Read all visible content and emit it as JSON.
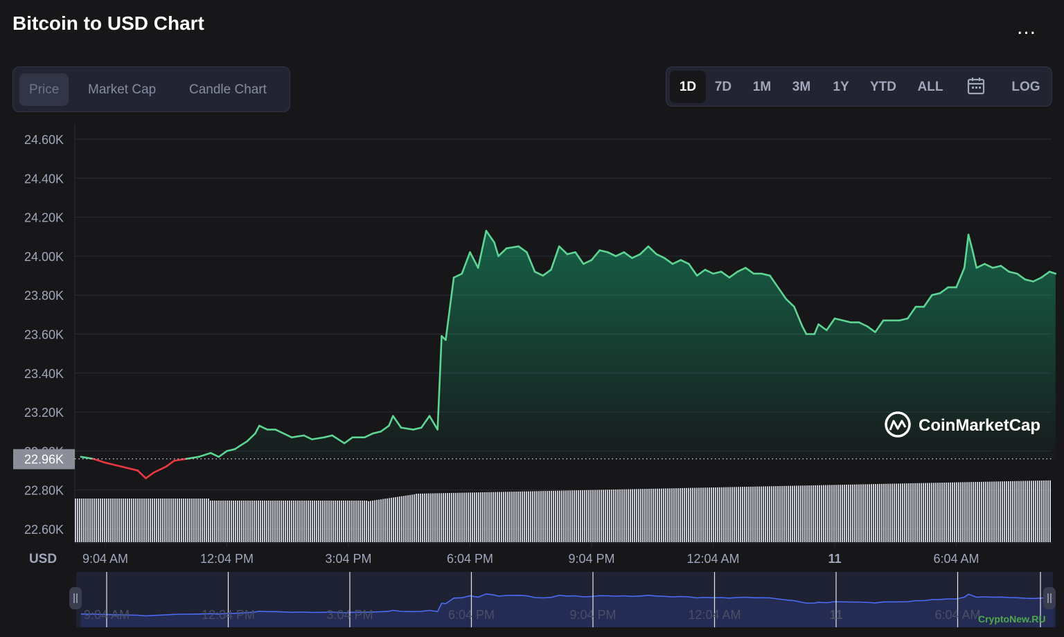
{
  "header": {
    "title": "Bitcoin to USD Chart",
    "more_label": "..."
  },
  "tabs": [
    {
      "label": "Price",
      "active": true
    },
    {
      "label": "Market Cap",
      "active": false
    },
    {
      "label": "Candle Chart",
      "active": false
    }
  ],
  "ranges": [
    {
      "label": "1D",
      "active": true
    },
    {
      "label": "7D",
      "active": false
    },
    {
      "label": "1M",
      "active": false
    },
    {
      "label": "3M",
      "active": false
    },
    {
      "label": "1Y",
      "active": false
    },
    {
      "label": "YTD",
      "active": false
    },
    {
      "label": "ALL",
      "active": false
    }
  ],
  "calendar_icon": "calendar-icon",
  "log_label": "LOG",
  "brand": {
    "name": "CoinMarketCap",
    "logo_icon": "coinmarketcap-logo-icon"
  },
  "watermark": "CryptoNew.RU",
  "colors": {
    "up": "#16c784",
    "up_line": "#5ed592",
    "down": "#ea3943",
    "background": "#17171a",
    "panel": "#222531",
    "navigator_line": "#4a6cf7"
  },
  "chart_data": {
    "type": "area",
    "title": "Bitcoin to USD Chart",
    "ylabel": "USD",
    "xlabel": "",
    "ylim": [
      22.55,
      24.65
    ],
    "y_unit": "K",
    "y_ticks": [
      "24.60K",
      "24.40K",
      "24.20K",
      "24.00K",
      "23.80K",
      "23.60K",
      "23.40K",
      "23.20K",
      "23.00K",
      "22.80K",
      "22.60K"
    ],
    "reference_value": 22.96,
    "reference_label": "22.96K",
    "x_ticks": [
      "9:04 AM",
      "12:04 PM",
      "3:04 PM",
      "6:04 PM",
      "9:04 PM",
      "12:04 AM",
      "11",
      "6:04 AM"
    ],
    "x_tick_hours": [
      0,
      3,
      6,
      9,
      12,
      15,
      18,
      21
    ],
    "x_unit": "hours after 9:04 AM",
    "xlim": [
      -0.6,
      23.45
    ],
    "series": [
      {
        "values": [
          [
            -0.6,
            22.97
          ],
          [
            -0.3,
            22.96
          ],
          [
            0.0,
            22.94
          ],
          [
            0.4,
            22.92
          ],
          [
            0.8,
            22.9
          ],
          [
            1.0,
            22.86
          ],
          [
            1.2,
            22.89
          ],
          [
            1.5,
            22.92
          ],
          [
            1.7,
            22.95
          ],
          [
            2.0,
            22.96
          ],
          [
            2.3,
            22.97
          ],
          [
            2.6,
            22.99
          ],
          [
            2.8,
            22.97
          ],
          [
            3.0,
            23.0
          ],
          [
            3.2,
            23.01
          ],
          [
            3.5,
            23.05
          ],
          [
            3.7,
            23.09
          ],
          [
            3.8,
            23.13
          ],
          [
            4.0,
            23.11
          ],
          [
            4.2,
            23.11
          ],
          [
            4.4,
            23.09
          ],
          [
            4.6,
            23.07
          ],
          [
            4.9,
            23.08
          ],
          [
            5.1,
            23.06
          ],
          [
            5.4,
            23.07
          ],
          [
            5.6,
            23.08
          ],
          [
            5.9,
            23.04
          ],
          [
            6.1,
            23.07
          ],
          [
            6.4,
            23.07
          ],
          [
            6.6,
            23.09
          ],
          [
            6.8,
            23.1
          ],
          [
            7.0,
            23.13
          ],
          [
            7.1,
            23.18
          ],
          [
            7.3,
            23.12
          ],
          [
            7.6,
            23.11
          ],
          [
            7.8,
            23.12
          ],
          [
            8.0,
            23.18
          ],
          [
            8.2,
            23.11
          ],
          [
            8.3,
            23.59
          ],
          [
            8.4,
            23.57
          ],
          [
            8.6,
            23.89
          ],
          [
            8.8,
            23.91
          ],
          [
            9.0,
            24.02
          ],
          [
            9.2,
            23.94
          ],
          [
            9.4,
            24.13
          ],
          [
            9.6,
            24.07
          ],
          [
            9.7,
            24.0
          ],
          [
            9.9,
            24.04
          ],
          [
            10.2,
            24.05
          ],
          [
            10.4,
            24.02
          ],
          [
            10.6,
            23.92
          ],
          [
            10.8,
            23.9
          ],
          [
            11.0,
            23.93
          ],
          [
            11.2,
            24.05
          ],
          [
            11.4,
            24.01
          ],
          [
            11.6,
            24.02
          ],
          [
            11.8,
            23.96
          ],
          [
            12.0,
            23.98
          ],
          [
            12.2,
            24.03
          ],
          [
            12.4,
            24.02
          ],
          [
            12.6,
            24.0
          ],
          [
            12.8,
            24.02
          ],
          [
            13.0,
            23.99
          ],
          [
            13.2,
            24.01
          ],
          [
            13.4,
            24.05
          ],
          [
            13.6,
            24.01
          ],
          [
            13.8,
            23.99
          ],
          [
            14.0,
            23.96
          ],
          [
            14.2,
            23.98
          ],
          [
            14.4,
            23.96
          ],
          [
            14.6,
            23.9
          ],
          [
            14.8,
            23.93
          ],
          [
            15.0,
            23.91
          ],
          [
            15.2,
            23.92
          ],
          [
            15.4,
            23.89
          ],
          [
            15.6,
            23.92
          ],
          [
            15.8,
            23.94
          ],
          [
            16.0,
            23.91
          ],
          [
            16.2,
            23.91
          ],
          [
            16.4,
            23.9
          ],
          [
            16.6,
            23.84
          ],
          [
            16.8,
            23.78
          ],
          [
            17.0,
            23.74
          ],
          [
            17.2,
            23.64
          ],
          [
            17.3,
            23.6
          ],
          [
            17.5,
            23.6
          ],
          [
            17.6,
            23.65
          ],
          [
            17.8,
            23.62
          ],
          [
            18.0,
            23.68
          ],
          [
            18.2,
            23.67
          ],
          [
            18.4,
            23.66
          ],
          [
            18.6,
            23.66
          ],
          [
            18.8,
            23.64
          ],
          [
            19.0,
            23.61
          ],
          [
            19.2,
            23.67
          ],
          [
            19.4,
            23.67
          ],
          [
            19.6,
            23.67
          ],
          [
            19.8,
            23.68
          ],
          [
            20.0,
            23.74
          ],
          [
            20.2,
            23.74
          ],
          [
            20.4,
            23.8
          ],
          [
            20.6,
            23.81
          ],
          [
            20.8,
            23.84
          ],
          [
            21.0,
            23.84
          ],
          [
            21.2,
            23.94
          ],
          [
            21.3,
            24.11
          ],
          [
            21.4,
            24.03
          ],
          [
            21.5,
            23.94
          ],
          [
            21.7,
            23.96
          ],
          [
            21.9,
            23.94
          ],
          [
            22.1,
            23.95
          ],
          [
            22.3,
            23.92
          ],
          [
            22.5,
            23.91
          ],
          [
            22.7,
            23.88
          ],
          [
            22.9,
            23.87
          ],
          [
            23.1,
            23.89
          ],
          [
            23.3,
            23.92
          ],
          [
            23.45,
            23.91
          ]
        ]
      }
    ],
    "volume_note": "grey volume bars along bottom",
    "navigator": {
      "x_ticks": [
        "9:04 AM",
        "12:04 PM",
        "3:04 PM",
        "6:04 PM",
        "9:04 PM",
        "12:04 AM",
        "11",
        "6:04 AM"
      ]
    }
  }
}
